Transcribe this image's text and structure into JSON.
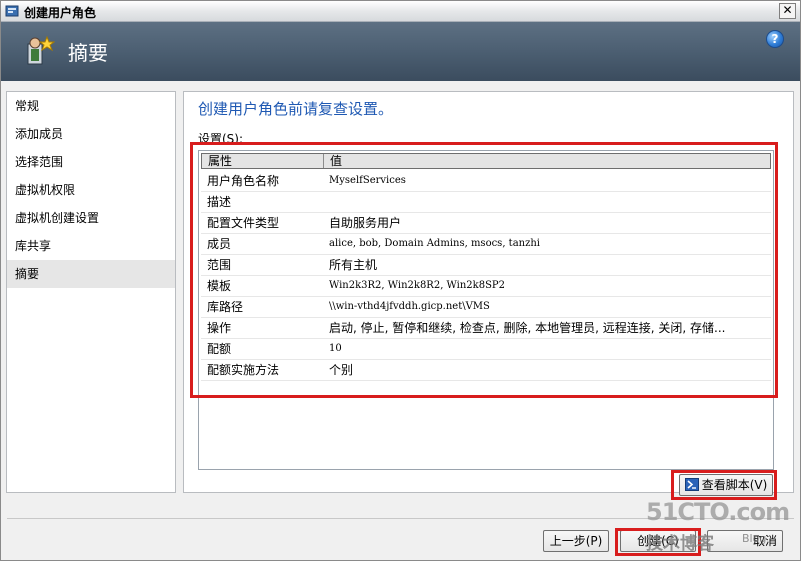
{
  "window": {
    "title": "创建用户角色",
    "close_glyph": "✕"
  },
  "banner": {
    "title": "摘要",
    "help_glyph": "?",
    "icon": "user-role-wizard-icon"
  },
  "nav": {
    "items": [
      {
        "label": "常规"
      },
      {
        "label": "添加成员"
      },
      {
        "label": "选择范围"
      },
      {
        "label": "虚拟机权限"
      },
      {
        "label": "虚拟机创建设置"
      },
      {
        "label": "库共享"
      },
      {
        "label": "摘要"
      }
    ],
    "active_index": 6
  },
  "content": {
    "heading": "创建用户角色前请复查设置。",
    "settings_label": "设置(S):",
    "columns": [
      "属性",
      "值"
    ],
    "rows": [
      {
        "prop": "用户角色名称",
        "val": "MyselfServices"
      },
      {
        "prop": "描述",
        "val": ""
      },
      {
        "prop": "配置文件类型",
        "val": "自助服务用户"
      },
      {
        "prop": "成员",
        "val": "alice, bob, Domain Admins, msocs, tanzhi"
      },
      {
        "prop": "范围",
        "val": "所有主机"
      },
      {
        "prop": "模板",
        "val": "Win2k3R2, Win2k8R2, Win2k8SP2"
      },
      {
        "prop": "库路径",
        "val": "\\\\win-vthd4jfvddh.gicp.net\\VMS"
      },
      {
        "prop": "操作",
        "val": "启动, 停止, 暂停和继续, 检查点, 删除, 本地管理员, 远程连接, 关闭, 存储..."
      },
      {
        "prop": "配额",
        "val": "10"
      },
      {
        "prop": "配额实施方法",
        "val": "个别"
      }
    ]
  },
  "buttons": {
    "view_script": "查看脚本(V)",
    "previous": "上一步(P)",
    "create": "创建(C)",
    "cancel": "取消"
  },
  "watermark": {
    "site": "51CTO.com",
    "subtitle": "技术博客",
    "blog": "Blog"
  },
  "colors": {
    "heading_blue": "#1f59b3",
    "highlight_red": "#d81d1d",
    "banner_slate": "#4a5d70"
  }
}
